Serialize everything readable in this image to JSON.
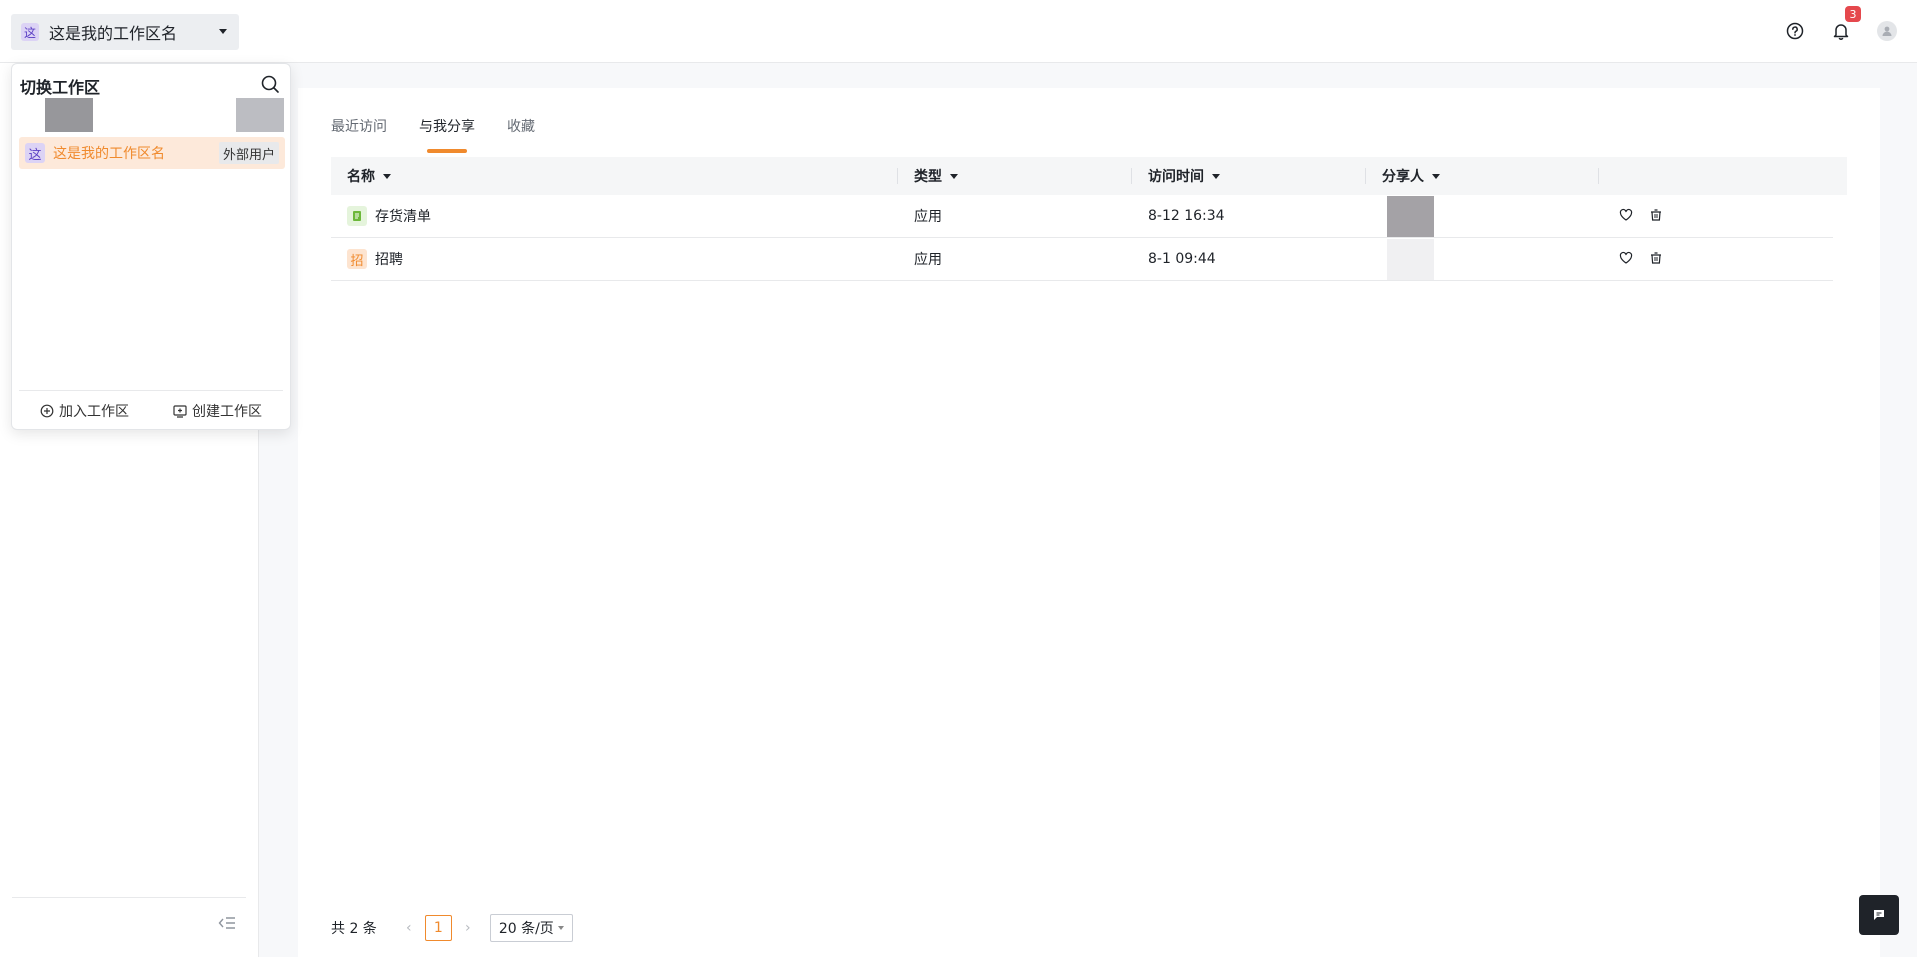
{
  "header": {
    "workspace_avatar": "这",
    "workspace_name": "这是我的工作区名",
    "notification_count": "3",
    "icons": [
      "help-icon",
      "bell-icon",
      "user-icon"
    ]
  },
  "workspace_panel": {
    "title": "切换工作区",
    "items": [
      {
        "avatar": "这",
        "name": "这是我的工作区名",
        "tag": "外部用户"
      }
    ],
    "join_label": "加入工作区",
    "create_label": "创建工作区"
  },
  "tabs": [
    {
      "label": "最近访问",
      "active": false
    },
    {
      "label": "与我分享",
      "active": true
    },
    {
      "label": "收藏",
      "active": false
    }
  ],
  "table": {
    "columns": [
      "名称",
      "类型",
      "访问时间",
      "分享人"
    ],
    "rows": [
      {
        "icon_text": "",
        "icon_color": "#e5f4dc",
        "name": "存货清单",
        "type": "应用",
        "time": "8-12 16:34",
        "sharer_color": "#a4a2a6"
      },
      {
        "icon_text": "招",
        "icon_color": "#fde4d0",
        "name": "招聘",
        "type": "应用",
        "time": "8-1 09:44",
        "sharer_color": "#f0f0f2"
      }
    ]
  },
  "pagination": {
    "total": "共 2 条",
    "current_page": "1",
    "page_size": "20 条/页"
  },
  "colors": {
    "accent": "#f08a2d",
    "badge": "#e5484d"
  }
}
